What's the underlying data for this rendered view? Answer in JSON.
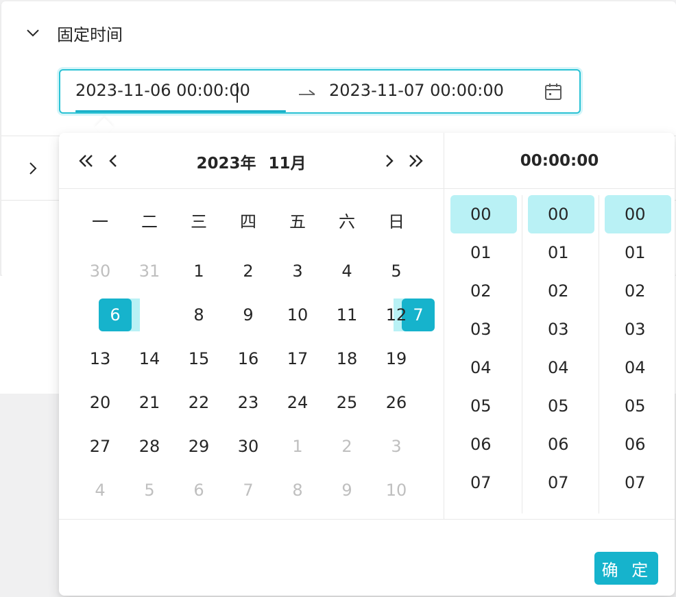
{
  "panels": [
    {
      "title": "固定时间",
      "expanded": true
    },
    {
      "title": "",
      "expanded": false
    }
  ],
  "range": {
    "start": "2023-11-06 00:00:00",
    "end": "2023-11-07 00:00:00",
    "separator_icon": "range-arrow-icon",
    "suffix_icon": "calendar-icon"
  },
  "calendar": {
    "year_label": "2023年",
    "month_label": "11月",
    "weekdays": [
      "一",
      "二",
      "三",
      "四",
      "五",
      "六",
      "日"
    ],
    "weeks": [
      [
        [
          "30",
          "muted"
        ],
        [
          "31",
          "muted"
        ],
        [
          "1",
          ""
        ],
        [
          "2",
          ""
        ],
        [
          "3",
          ""
        ],
        [
          "4",
          ""
        ],
        [
          "5",
          ""
        ]
      ],
      [
        [
          "6",
          "range-start"
        ],
        [
          "7",
          "range-end"
        ],
        [
          "8",
          ""
        ],
        [
          "9",
          ""
        ],
        [
          "10",
          ""
        ],
        [
          "11",
          ""
        ],
        [
          "12",
          ""
        ]
      ],
      [
        [
          "13",
          ""
        ],
        [
          "14",
          ""
        ],
        [
          "15",
          ""
        ],
        [
          "16",
          ""
        ],
        [
          "17",
          ""
        ],
        [
          "18",
          ""
        ],
        [
          "19",
          ""
        ]
      ],
      [
        [
          "20",
          ""
        ],
        [
          "21",
          ""
        ],
        [
          "22",
          ""
        ],
        [
          "23",
          ""
        ],
        [
          "24",
          ""
        ],
        [
          "25",
          ""
        ],
        [
          "26",
          ""
        ]
      ],
      [
        [
          "27",
          ""
        ],
        [
          "28",
          ""
        ],
        [
          "29",
          ""
        ],
        [
          "30",
          ""
        ],
        [
          "1",
          "muted"
        ],
        [
          "2",
          "muted"
        ],
        [
          "3",
          "muted"
        ]
      ],
      [
        [
          "4",
          "muted"
        ],
        [
          "5",
          "muted"
        ],
        [
          "6",
          "muted"
        ],
        [
          "7",
          "muted"
        ],
        [
          "8",
          "muted"
        ],
        [
          "9",
          "muted"
        ],
        [
          "10",
          "muted"
        ]
      ]
    ]
  },
  "time": {
    "header": "00:00:00",
    "hours": [
      "00",
      "01",
      "02",
      "03",
      "04",
      "05",
      "06",
      "07"
    ],
    "minutes": [
      "00",
      "01",
      "02",
      "03",
      "04",
      "05",
      "06",
      "07"
    ],
    "seconds": [
      "00",
      "01",
      "02",
      "03",
      "04",
      "05",
      "06",
      "07"
    ],
    "selected_hour": "00",
    "selected_minute": "00",
    "selected_second": "00"
  },
  "footer": {
    "ok_label": "确 定"
  },
  "colors": {
    "accent": "#16b3cc",
    "range_fill": "#b9f1f5",
    "focus_border": "#2ac2d4"
  }
}
